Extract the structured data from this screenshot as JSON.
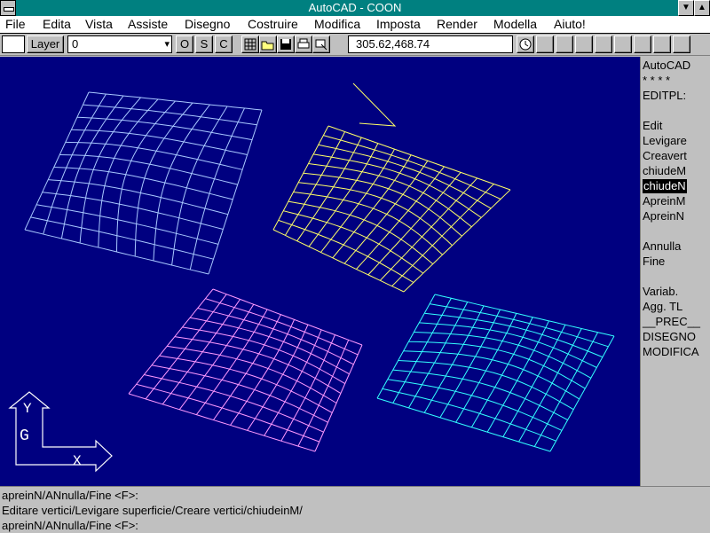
{
  "window": {
    "title": "AutoCAD - COON"
  },
  "menubar": [
    {
      "label": "File"
    },
    {
      "label": "Edita"
    },
    {
      "label": "Vista"
    },
    {
      "label": "Assiste"
    },
    {
      "label": "Disegno"
    },
    {
      "label": "Costruire"
    },
    {
      "label": "Modifica"
    },
    {
      "label": "Imposta"
    },
    {
      "label": "Render"
    },
    {
      "label": "Modella"
    },
    {
      "label": "Aiuto!"
    }
  ],
  "toolbar": {
    "layer_label": "Layer",
    "layer_value": "0",
    "ortho": "O",
    "snap": "S",
    "coords_toggle": "C",
    "coordinates": "305.62,468.74",
    "icons": [
      "grid-icon",
      "open-icon",
      "save-icon",
      "print-icon",
      "pointer-icon"
    ]
  },
  "sidemenu": {
    "items": [
      "AutoCAD",
      "* * * *",
      "EDITPL:",
      "",
      "Edit",
      "Levigare",
      "Creavert",
      "chiudeM",
      "chiudeN",
      "ApreinM",
      "ApreinN",
      "",
      "Annulla",
      "Fine",
      "",
      "Variab.",
      "Agg. TL",
      "__PREC__",
      "DISEGNO",
      "MODIFICA"
    ],
    "selected_index": 8
  },
  "command_lines": [
    "apreinN/ANnulla/Fine <F>:",
    "Editare vertici/Levigare superficie/Creare vertici/chiudeinM/",
    "apreinN/ANnulla/Fine <F>:"
  ],
  "ucs_icon": {
    "y_label": "Y",
    "x_label": "X",
    "g_label": "G"
  },
  "colors": {
    "titlebar": "#008080",
    "canvas": "#000080",
    "mesh_blue": "#a8c8ff",
    "mesh_yellow": "#ffff66",
    "mesh_magenta": "#ff99ff",
    "mesh_cyan": "#33ffff"
  }
}
